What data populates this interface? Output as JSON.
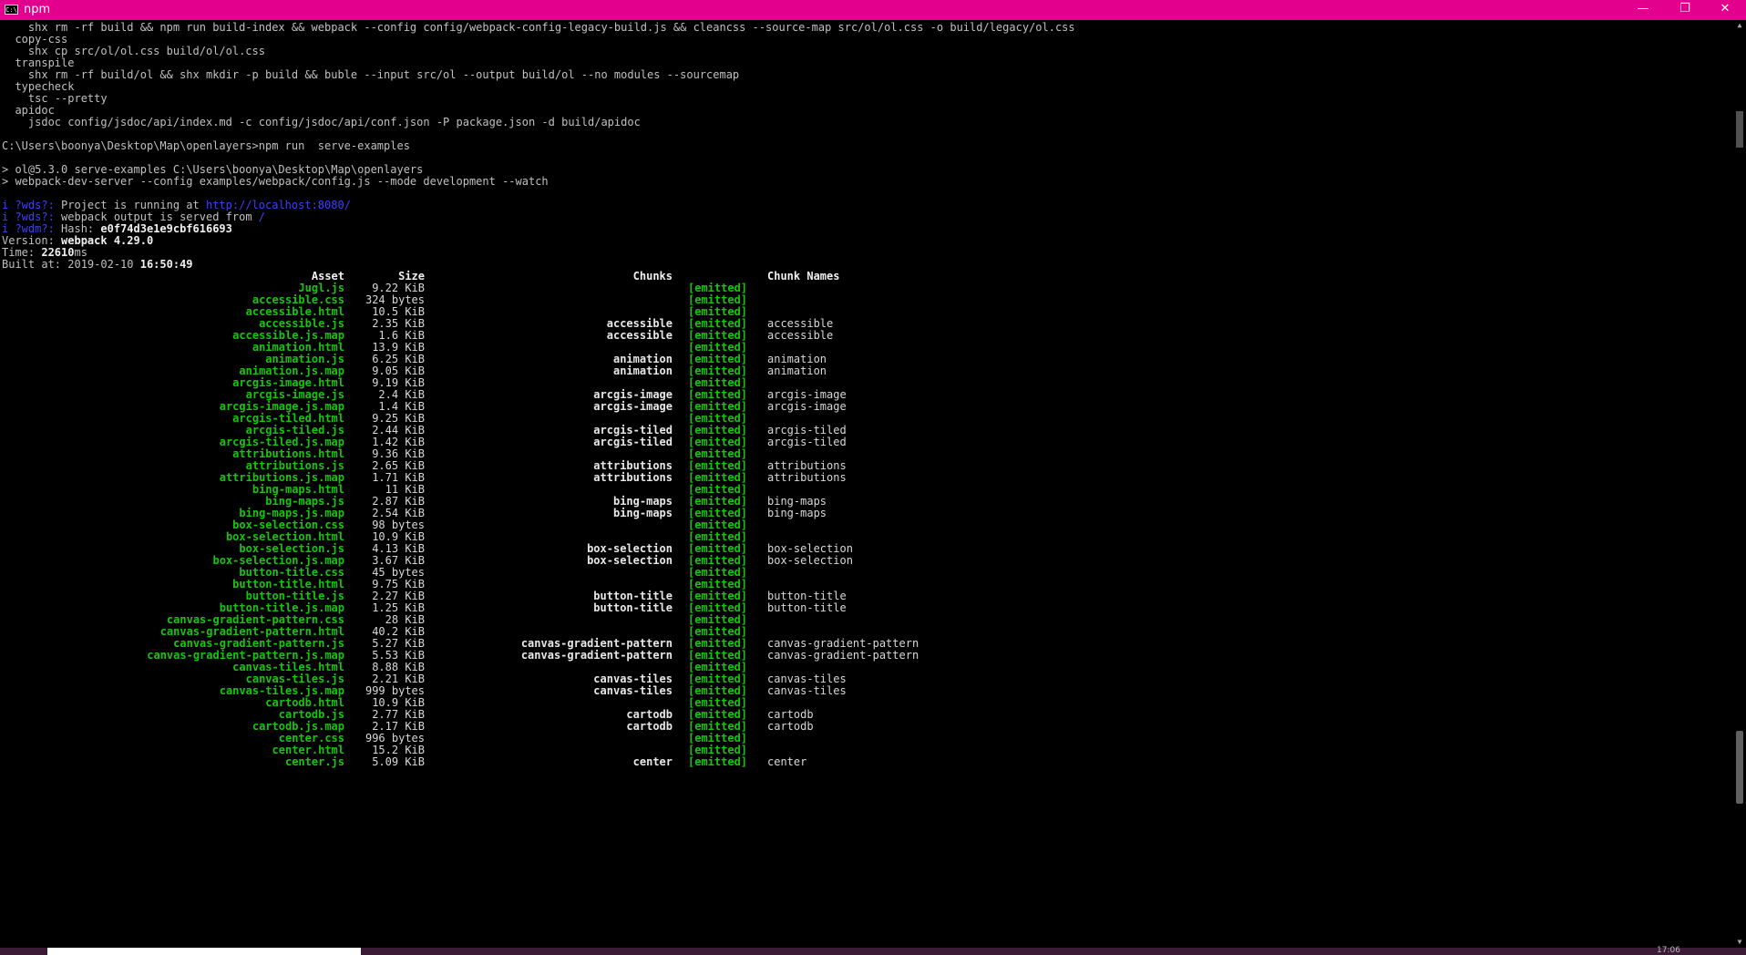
{
  "window": {
    "title": "npm",
    "icon_text": "C:\\",
    "icons": {
      "minimize": "minimize-icon",
      "maximize": "restore-icon",
      "close": "close-icon"
    },
    "accent_color": "#e3008c"
  },
  "console": {
    "lines": [
      "    shx rm -rf build && npm run build-index && webpack --config config/webpack-config-legacy-build.js && cleancss --source-map src/ol/ol.css -o build/legacy/ol.css",
      "  copy-css",
      "    shx cp src/ol/ol.css build/ol/ol.css",
      "  transpile",
      "    shx rm -rf build/ol && shx mkdir -p build && buble --input src/ol --output build/ol --no modules --sourcemap",
      "  typecheck",
      "    tsc --pretty",
      "  apidoc",
      "    jsdoc config/jsdoc/api/index.md -c config/jsdoc/api/conf.json -P package.json -d build/apidoc",
      "",
      "C:\\Users\\boonya\\Desktop\\Map\\openlayers>npm run  serve-examples",
      "",
      "> ol@5.3.0 serve-examples C:\\Users\\boonya\\Desktop\\Map\\openlayers",
      "> webpack-dev-server --config examples/webpack/config.js --mode development --watch",
      ""
    ],
    "wds": {
      "prefix": "i ?wds?: ",
      "running_text": "Project is running at ",
      "url": "http://localhost:8080/",
      "served_text": "webpack output is served from ",
      "served_path": "/",
      "wdm_prefix": "i ?wdm?: ",
      "hash_label": "Hash: ",
      "hash": "e0f74d3e1e9cbf616693"
    },
    "version_label": "Version: ",
    "version": "webpack 4.29.0",
    "time_label": "Time: ",
    "time": "22610",
    "time_unit": "ms",
    "built_label": "Built at: ",
    "built_date": "2019-02-10 ",
    "built_time": "16:50:49"
  },
  "table": {
    "headers": {
      "asset": "Asset",
      "size": "Size",
      "chunks": "Chunks",
      "emitted": "",
      "names": "Chunk Names"
    },
    "rows": [
      {
        "asset": "Jugl.js",
        "size": "9.22 KiB",
        "chunks": "",
        "emitted": "[emitted]",
        "names": ""
      },
      {
        "asset": "accessible.css",
        "size": "324 bytes",
        "chunks": "",
        "emitted": "[emitted]",
        "names": ""
      },
      {
        "asset": "accessible.html",
        "size": "10.5 KiB",
        "chunks": "",
        "emitted": "[emitted]",
        "names": ""
      },
      {
        "asset": "accessible.js",
        "size": "2.35 KiB",
        "chunks": "accessible",
        "emitted": "[emitted]",
        "names": "accessible"
      },
      {
        "asset": "accessible.js.map",
        "size": "1.6 KiB",
        "chunks": "accessible",
        "emitted": "[emitted]",
        "names": "accessible"
      },
      {
        "asset": "animation.html",
        "size": "13.9 KiB",
        "chunks": "",
        "emitted": "[emitted]",
        "names": ""
      },
      {
        "asset": "animation.js",
        "size": "6.25 KiB",
        "chunks": "animation",
        "emitted": "[emitted]",
        "names": "animation"
      },
      {
        "asset": "animation.js.map",
        "size": "9.05 KiB",
        "chunks": "animation",
        "emitted": "[emitted]",
        "names": "animation"
      },
      {
        "asset": "arcgis-image.html",
        "size": "9.19 KiB",
        "chunks": "",
        "emitted": "[emitted]",
        "names": ""
      },
      {
        "asset": "arcgis-image.js",
        "size": "2.4 KiB",
        "chunks": "arcgis-image",
        "emitted": "[emitted]",
        "names": "arcgis-image"
      },
      {
        "asset": "arcgis-image.js.map",
        "size": "1.4 KiB",
        "chunks": "arcgis-image",
        "emitted": "[emitted]",
        "names": "arcgis-image"
      },
      {
        "asset": "arcgis-tiled.html",
        "size": "9.25 KiB",
        "chunks": "",
        "emitted": "[emitted]",
        "names": ""
      },
      {
        "asset": "arcgis-tiled.js",
        "size": "2.44 KiB",
        "chunks": "arcgis-tiled",
        "emitted": "[emitted]",
        "names": "arcgis-tiled"
      },
      {
        "asset": "arcgis-tiled.js.map",
        "size": "1.42 KiB",
        "chunks": "arcgis-tiled",
        "emitted": "[emitted]",
        "names": "arcgis-tiled"
      },
      {
        "asset": "attributions.html",
        "size": "9.36 KiB",
        "chunks": "",
        "emitted": "[emitted]",
        "names": ""
      },
      {
        "asset": "attributions.js",
        "size": "2.65 KiB",
        "chunks": "attributions",
        "emitted": "[emitted]",
        "names": "attributions"
      },
      {
        "asset": "attributions.js.map",
        "size": "1.71 KiB",
        "chunks": "attributions",
        "emitted": "[emitted]",
        "names": "attributions"
      },
      {
        "asset": "bing-maps.html",
        "size": "11 KiB",
        "chunks": "",
        "emitted": "[emitted]",
        "names": ""
      },
      {
        "asset": "bing-maps.js",
        "size": "2.87 KiB",
        "chunks": "bing-maps",
        "emitted": "[emitted]",
        "names": "bing-maps"
      },
      {
        "asset": "bing-maps.js.map",
        "size": "2.54 KiB",
        "chunks": "bing-maps",
        "emitted": "[emitted]",
        "names": "bing-maps"
      },
      {
        "asset": "box-selection.css",
        "size": "98 bytes",
        "chunks": "",
        "emitted": "[emitted]",
        "names": ""
      },
      {
        "asset": "box-selection.html",
        "size": "10.9 KiB",
        "chunks": "",
        "emitted": "[emitted]",
        "names": ""
      },
      {
        "asset": "box-selection.js",
        "size": "4.13 KiB",
        "chunks": "box-selection",
        "emitted": "[emitted]",
        "names": "box-selection"
      },
      {
        "asset": "box-selection.js.map",
        "size": "3.67 KiB",
        "chunks": "box-selection",
        "emitted": "[emitted]",
        "names": "box-selection"
      },
      {
        "asset": "button-title.css",
        "size": "45 bytes",
        "chunks": "",
        "emitted": "[emitted]",
        "names": ""
      },
      {
        "asset": "button-title.html",
        "size": "9.75 KiB",
        "chunks": "",
        "emitted": "[emitted]",
        "names": ""
      },
      {
        "asset": "button-title.js",
        "size": "2.27 KiB",
        "chunks": "button-title",
        "emitted": "[emitted]",
        "names": "button-title"
      },
      {
        "asset": "button-title.js.map",
        "size": "1.25 KiB",
        "chunks": "button-title",
        "emitted": "[emitted]",
        "names": "button-title"
      },
      {
        "asset": "canvas-gradient-pattern.css",
        "size": "28 KiB",
        "chunks": "",
        "emitted": "[emitted]",
        "names": ""
      },
      {
        "asset": "canvas-gradient-pattern.html",
        "size": "40.2 KiB",
        "chunks": "",
        "emitted": "[emitted]",
        "names": ""
      },
      {
        "asset": "canvas-gradient-pattern.js",
        "size": "5.27 KiB",
        "chunks": "canvas-gradient-pattern",
        "emitted": "[emitted]",
        "names": "canvas-gradient-pattern"
      },
      {
        "asset": "canvas-gradient-pattern.js.map",
        "size": "5.53 KiB",
        "chunks": "canvas-gradient-pattern",
        "emitted": "[emitted]",
        "names": "canvas-gradient-pattern"
      },
      {
        "asset": "canvas-tiles.html",
        "size": "8.88 KiB",
        "chunks": "",
        "emitted": "[emitted]",
        "names": ""
      },
      {
        "asset": "canvas-tiles.js",
        "size": "2.21 KiB",
        "chunks": "canvas-tiles",
        "emitted": "[emitted]",
        "names": "canvas-tiles"
      },
      {
        "asset": "canvas-tiles.js.map",
        "size": "999 bytes",
        "chunks": "canvas-tiles",
        "emitted": "[emitted]",
        "names": "canvas-tiles"
      },
      {
        "asset": "cartodb.html",
        "size": "10.9 KiB",
        "chunks": "",
        "emitted": "[emitted]",
        "names": ""
      },
      {
        "asset": "cartodb.js",
        "size": "2.77 KiB",
        "chunks": "cartodb",
        "emitted": "[emitted]",
        "names": "cartodb"
      },
      {
        "asset": "cartodb.js.map",
        "size": "2.17 KiB",
        "chunks": "cartodb",
        "emitted": "[emitted]",
        "names": "cartodb"
      },
      {
        "asset": "center.css",
        "size": "996 bytes",
        "chunks": "",
        "emitted": "[emitted]",
        "names": ""
      },
      {
        "asset": "center.html",
        "size": "15.2 KiB",
        "chunks": "",
        "emitted": "[emitted]",
        "names": ""
      },
      {
        "asset": "center.js",
        "size": "5.09 KiB",
        "chunks": "center",
        "emitted": "[emitted]",
        "names": "center"
      }
    ]
  },
  "taskbar": {
    "clock": "17:06"
  }
}
